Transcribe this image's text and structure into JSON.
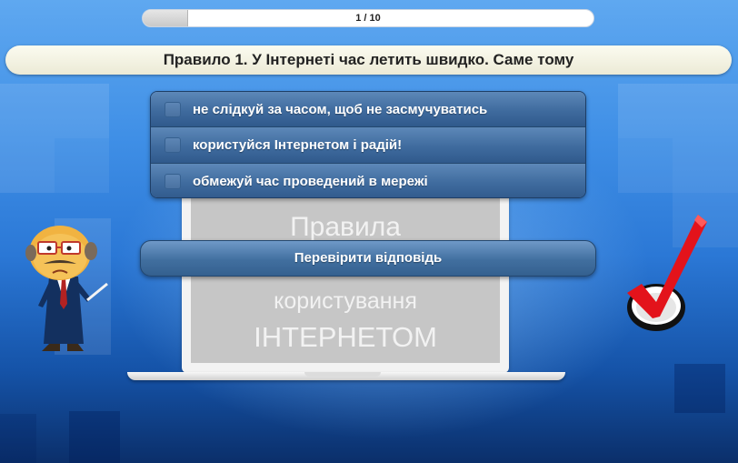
{
  "progress": {
    "text": "1 / 10",
    "current": 1,
    "total": 10
  },
  "question": {
    "text": "Правило 1. У Інтернеті час летить швидко. Саме тому"
  },
  "options": [
    {
      "label": "не слідкуй за часом, щоб не засмучуватись",
      "checked": false
    },
    {
      "label": "користуйся Інтернетом і радій!",
      "checked": false
    },
    {
      "label": "обмежуй час проведений в мережі",
      "checked": false
    }
  ],
  "check_button": {
    "label": "Перевірити відповідь"
  },
  "monitor": {
    "line1": "Правила",
    "line2": "користування",
    "line3": "ІНТЕРНЕТОМ"
  },
  "images": {
    "character": "teacher-character",
    "checkmark": "red-checkmark-icon"
  },
  "colors": {
    "option_bg": "#3f6b9e",
    "question_bg": "#f3f1e0",
    "checkmark": "#e3131b",
    "background": "#2b78d6"
  }
}
